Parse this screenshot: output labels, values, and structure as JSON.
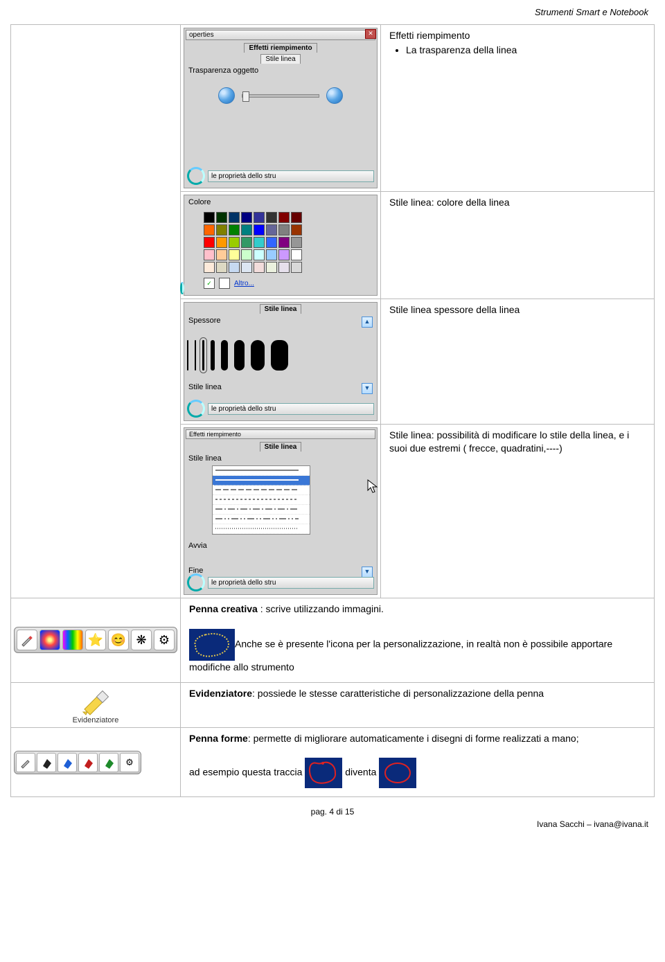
{
  "header": "Strumenti Smart e Notebook",
  "row1": {
    "panel": {
      "titlebar": "operties",
      "tab1": "Effetti riempimento",
      "tab2": "Stile linea",
      "label": "Trasparenza oggetto",
      "footer_btn": "le proprietà dello stru"
    },
    "desc_hd": "Effetti riempimento",
    "desc_li": "La trasparenza della linea"
  },
  "row2": {
    "color_label": "Colore",
    "altro": "Altro...",
    "desc": "Stile linea: colore della linea",
    "colors": [
      "#000000",
      "#003300",
      "#003366",
      "#000080",
      "#333399",
      "#333333",
      "#800000",
      "#660000",
      "#ff6600",
      "#808000",
      "#008000",
      "#008080",
      "#0000ff",
      "#666699",
      "#808080",
      "#993300",
      "#ff0000",
      "#ff9900",
      "#99cc00",
      "#339966",
      "#33cccc",
      "#3366ff",
      "#800080",
      "#969696",
      "#ffc0cb",
      "#ffcc99",
      "#ffff99",
      "#ccffcc",
      "#ccffff",
      "#99ccff",
      "#cc99ff",
      "#ffffff",
      "#fdeada",
      "#ddd9c3",
      "#c6d9f1",
      "#dce6f2",
      "#f2dcdb",
      "#ebf1de",
      "#e6e0ec",
      "#d9d9d9"
    ]
  },
  "row3": {
    "tab": "Stile linea",
    "label": "Spessore",
    "bottom": "Stile linea",
    "footer_btn": "le proprietà dello stru",
    "desc": "Stile linea spessore della linea"
  },
  "row4": {
    "top": "Effetti riempimento",
    "tab": "Stile linea",
    "label1": "Stile linea",
    "label2": "Avvia",
    "label3": "Fine",
    "footer_btn": "le proprietà dello stru",
    "desc": "Stile linea: possibilità di modificare lo stile della linea, e i suoi due estremi ( frecce, quadratini,----)"
  },
  "row5": {
    "hd1_bold": "Penna creativa",
    "hd1_rest": " : scrive utilizzando immagini.",
    "p1": "Anche se è presente l'icona per la personalizzazione, in realtà non è possibile apportare modifiche allo strumento"
  },
  "row6": {
    "figlabel": "Evidenziatore",
    "hd_bold": "Evidenziatore",
    "hd_rest": ": possiede le stesse caratteristiche di personalizzazione della penna"
  },
  "row7": {
    "hd_bold": "Penna forme",
    "hd_rest": ":  permette di migliorare automaticamente i disegni di forme realizzati a mano;",
    "p2a": "ad esempio questa traccia ",
    "p2b": " diventa "
  },
  "footer": {
    "page": "pag. 4 di 15",
    "author": "Ivana Sacchi – ivana@ivana.it"
  }
}
